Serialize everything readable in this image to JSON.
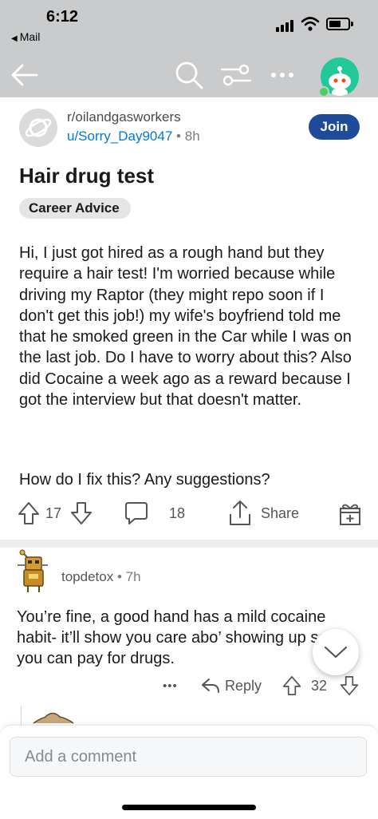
{
  "status": {
    "time": "6:12",
    "back_app": "Mail"
  },
  "nav": {
    "icons": [
      "back-arrow-icon",
      "search-icon",
      "filter-icon",
      "more-icon",
      "user-avatar"
    ]
  },
  "post": {
    "subreddit": "r/oilandgasworkers",
    "author": "u/Sorry_Day9047",
    "separator": "•",
    "age": "8h",
    "join_label": "Join",
    "title": "Hair drug test",
    "flair": "Career Advice",
    "body": "Hi, I just got hired as a rough hand but they require a hair test! I'm worried because while driving my Raptor (they might repo soon if I don't get this job!) my wife's boyfriend told me that he smoked green in the Car while I was on the last job. Do I have to worry about this? Also did Cocaine a week ago as a reward because I got the interview but that doesn't matter.",
    "question": "How do I fix this? Any suggestions?",
    "votes": "17",
    "comments": "18",
    "share_label": "Share"
  },
  "comment": {
    "author": "topdetox",
    "separator": "•",
    "age": "7h",
    "body": "You’re fine, a good hand has a mild cocaine habit- it’ll show you care abo’ showing up so you can pay for drugs.",
    "more_label": "•••",
    "reply_label": "Reply",
    "votes": "32"
  },
  "composer": {
    "placeholder": "Add a comment"
  },
  "colors": {
    "header_bg": "#c9cbcd",
    "join_bg": "#1e4b9a",
    "link_blue": "#0079d3",
    "avatar_green": "#20c997",
    "online_green": "#46d160"
  }
}
